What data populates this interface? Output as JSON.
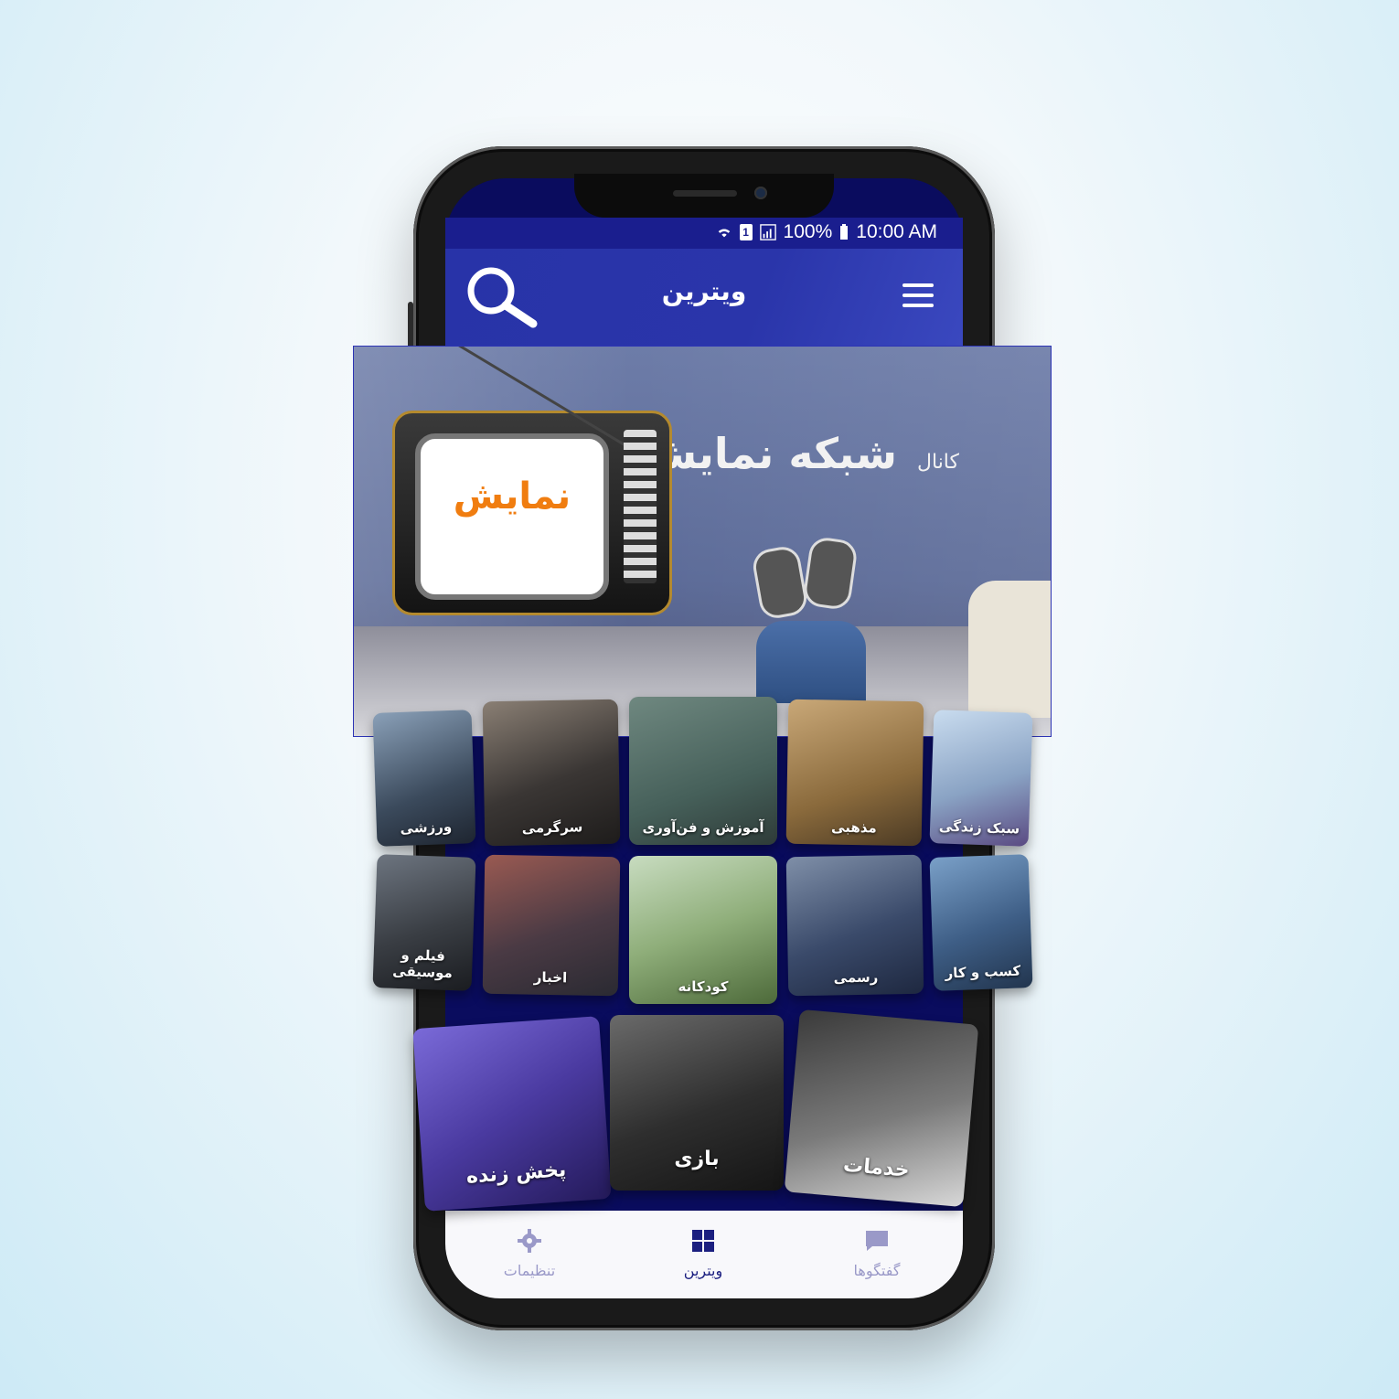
{
  "status_bar": {
    "battery": "100%",
    "time": "10:00 AM",
    "sim_label": "1",
    "icons": [
      "wifi-icon",
      "sim-icon",
      "signal-icon",
      "battery-icon"
    ]
  },
  "app_bar": {
    "title": "ویترین",
    "search_icon": "search-icon",
    "menu_icon": "menu-icon"
  },
  "banner": {
    "title": "شبکه نمایش",
    "prefix": "کانال",
    "tv_logo": "نمایش"
  },
  "categories_row1": [
    {
      "label": "ورزشی",
      "icon": "sport-image"
    },
    {
      "label": "سرگرمی",
      "icon": "gamepad-image"
    },
    {
      "label": "آموزش و فن‌آوری",
      "icon": "education-image"
    },
    {
      "label": "مذهبی",
      "icon": "religious-image"
    },
    {
      "label": "سبک زندگی",
      "icon": "lifestyle-image"
    }
  ],
  "categories_row2": [
    {
      "label": "فیلم و موسیقی",
      "icon": "music-image"
    },
    {
      "label": "اخبار",
      "icon": "news-image"
    },
    {
      "label": "کودکانه",
      "icon": "kids-image"
    },
    {
      "label": "رسمی",
      "icon": "official-image"
    },
    {
      "label": "کسب و کار",
      "icon": "business-image"
    }
  ],
  "categories_big": [
    {
      "label": "پخش زنده",
      "icon": "live-image"
    },
    {
      "label": "بازی",
      "icon": "game-image"
    },
    {
      "label": "خدمات",
      "icon": "services-image"
    }
  ],
  "bottom_nav": [
    {
      "label": "تنظیمات",
      "icon": "gear-icon",
      "active": false
    },
    {
      "label": "ویترین",
      "icon": "grid-icon",
      "active": true
    },
    {
      "label": "گفتگوها",
      "icon": "chat-icon",
      "active": false
    }
  ],
  "colors": {
    "primary": "#2a35aa",
    "status_bar": "#1a1e8e",
    "grid_bg": "#0a0c5e",
    "active_tab": "#1b1f80",
    "inactive_tab": "#9a99c8"
  }
}
